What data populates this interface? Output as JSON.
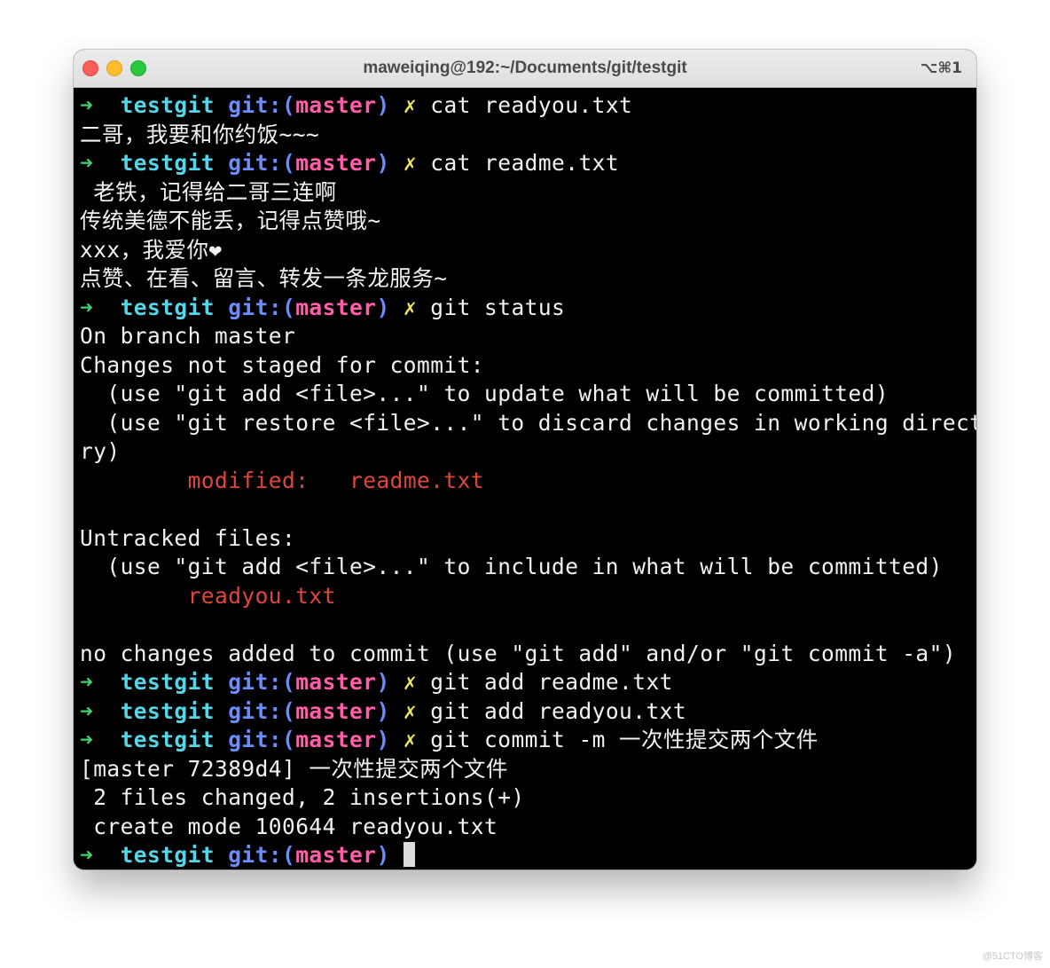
{
  "window": {
    "title": "maweiqing@192:~/Documents/git/testgit",
    "shortcut": "⌥⌘1"
  },
  "prompt": {
    "arrow": "➜",
    "dir": "testgit",
    "git": "git:(",
    "branch": "master",
    "close_paren": ")",
    "dirty_mark": "✗"
  },
  "commands": {
    "c1": "cat readyou.txt",
    "c2": "cat readme.txt",
    "c3": "git status",
    "c4": "git add readme.txt",
    "c5": "git add readyou.txt",
    "c6": "git commit -m 一次性提交两个文件"
  },
  "output": {
    "l1": "二哥，我要和你约饭~~~",
    "l2": " 老铁，记得给二哥三连啊",
    "l3": "传统美德不能丢，记得点赞哦~",
    "l4": "xxx，我爱你❤",
    "l5": "点赞、在看、留言、转发一条龙服务~",
    "l6": "On branch master",
    "l7": "Changes not staged for commit:",
    "l8": "  (use \"git add <file>...\" to update what will be committed)",
    "l9": "  (use \"git restore <file>...\" to discard changes in working directo",
    "l10": "ry)",
    "l11_label": "modified:",
    "l11_file": "readme.txt",
    "l12": "Untracked files:",
    "l13": "  (use \"git add <file>...\" to include in what will be committed)",
    "l14_file": "readyou.txt",
    "l15": "no changes added to commit (use \"git add\" and/or \"git commit -a\")",
    "l16": "[master 72389d4] 一次性提交两个文件",
    "l17": " 2 files changed, 2 insertions(+)",
    "l18": " create mode 100644 readyou.txt"
  },
  "watermark": "@51CTO博客",
  "colors": {
    "prompt_arrow": "#3fd16b",
    "prompt_dir": "#55d6e8",
    "prompt_git": "#6a8cff",
    "prompt_branch": "#ff5fa8",
    "prompt_dirty": "#f1e45c",
    "status_red": "#e0463c",
    "terminal_bg": "#000000",
    "terminal_fg": "#f2f2f2"
  }
}
